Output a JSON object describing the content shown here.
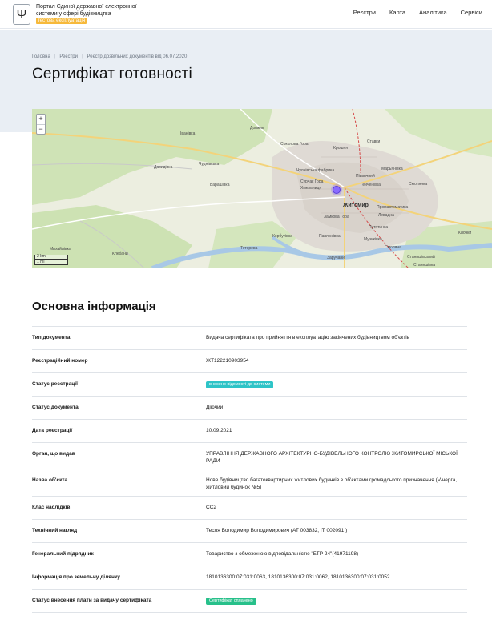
{
  "header": {
    "logo_icon": "trident-icon",
    "brand_text": "Портал Єдиної державної електронної системи у сфері будівництва",
    "brand_badge": "тестова експлуатація",
    "nav": [
      "Реєстри",
      "Карта",
      "Аналітика",
      "Сервіси"
    ]
  },
  "breadcrumb": [
    "Головна",
    "Реєстри",
    "Реєстр дозвільних документів від 06.07.2020"
  ],
  "page_title": "Сертифікат готовності",
  "map": {
    "zoom_in": "+",
    "zoom_out": "−",
    "scale_km": "2 km",
    "scale_mi": "1 mi",
    "labels": [
      "Іванівка",
      "Довжик",
      "Соколова Гора",
      "Крошня",
      "Ставки",
      "Давидівка",
      "Чуднівська",
      "Чулнівська фабрика",
      "Піввнчний",
      "Марьянівка",
      "Барашівка",
      "Сурчак Гора",
      "Хмельниця",
      "Гейченівка",
      "Житомир",
      "Смолянка",
      "Промавтоматика",
      "Левадна",
      "Замкова Гора",
      "Путятинка",
      "Корбутівка",
      "Павлюківка",
      "Музиківка",
      "Смоляна",
      "Станишівський",
      "Михайлівка",
      "Клочки",
      "Заручани",
      "Тетерева",
      "Клебани",
      "Станишівка"
    ],
    "highlight_color": "#8a6cff"
  },
  "section_title": "Основна інформація",
  "rows": [
    {
      "key": "Тип документа",
      "value": "Видача сертифіката про прийняття в експлуатацію закінчених будівництвом об'єктів"
    },
    {
      "key": "Реєстраційний номер",
      "value": "ЖТ122210903954"
    },
    {
      "key": "Статус реєстрації",
      "badge": "внесено відомості до системи",
      "badge_color": "#2ec4c7"
    },
    {
      "key": "Статус документа",
      "value": "Діючий"
    },
    {
      "key": "Дата реєстрації",
      "value": "10.09.2021"
    },
    {
      "key": "Орган, що видав",
      "value": "УПРАВЛІННЯ ДЕРЖАВНОГО АРХІТЕКТУРНО-БУДІВЕЛЬНОГО КОНТРОЛЮ ЖИТОМИРСЬКОЇ МІСЬКОЇ РАДИ"
    },
    {
      "key": "Назва об'єкта",
      "value": "Нове будівництво багатоквартирних житлових будинків з об'єктами громадського призначення (V-черга, житловий будинок №5)"
    },
    {
      "key": "Клас наслідків",
      "value": "СС2"
    },
    {
      "key": "Технічний нагляд",
      "value": "Тесля Володимир Володимирович (АТ 003832, ІТ 002091 )"
    },
    {
      "key": "Генеральний підрядник",
      "value": "Товариство з обмеженою відповідальністю \"БТР 24\"(41971198)"
    },
    {
      "key": "Інформація про земельну ділянку",
      "value": "1810136300:07:031:0063, 1810136300:07:031:0062, 1810136300:07:031:0052"
    },
    {
      "key": "Статус внесення плати за видачу сертифіката",
      "badge": "Сертифікат сплачено",
      "badge_color": "#27c08a"
    }
  ]
}
